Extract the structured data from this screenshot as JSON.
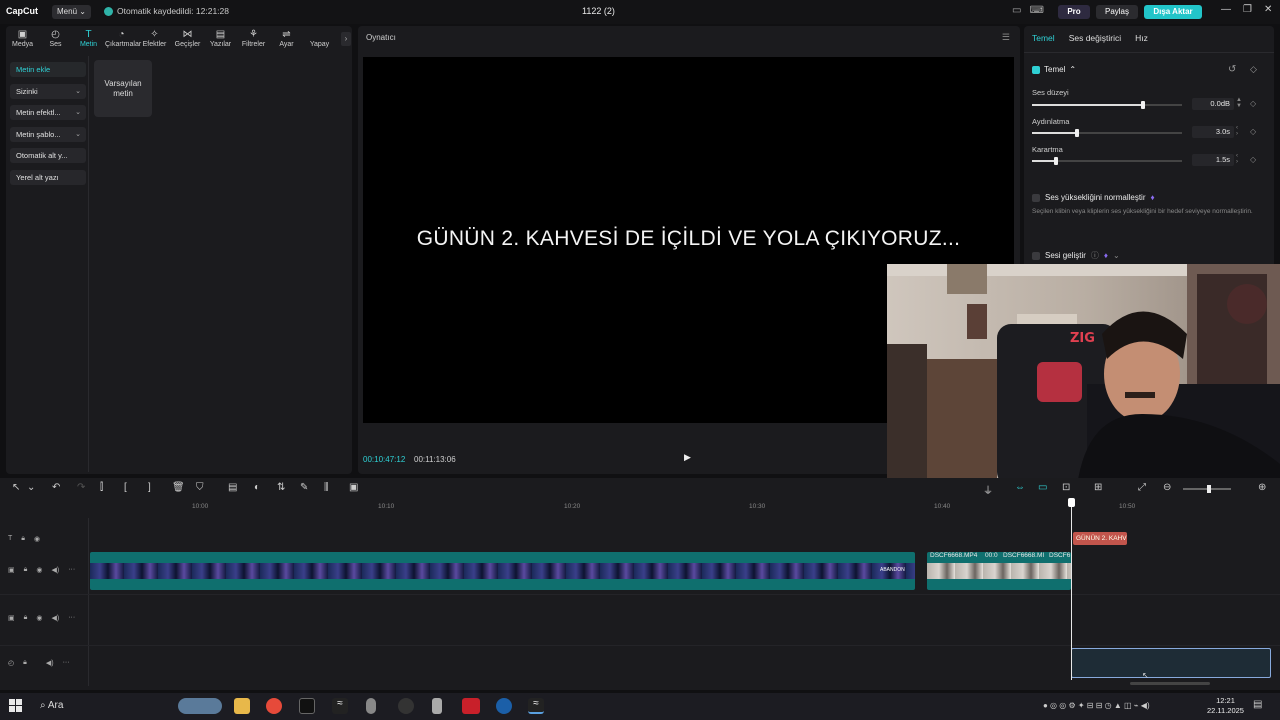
{
  "titlebar": {
    "logo": "CapCut",
    "menu_label": "Menü",
    "autosave_text": "Otomatik kaydedildi: 12:21:28",
    "project_title": "1122 (2)",
    "pro_label": "Pro",
    "share_label": "Paylaş",
    "export_label": "Dışa Aktar"
  },
  "left_tabs": [
    {
      "label": "Medya",
      "icon": "media-icon"
    },
    {
      "label": "Ses",
      "icon": "audio-icon"
    },
    {
      "label": "Metin",
      "icon": "text-icon"
    },
    {
      "label": "Çıkartmalar",
      "icon": "sticker-icon"
    },
    {
      "label": "Efektler",
      "icon": "effects-icon"
    },
    {
      "label": "Geçişler",
      "icon": "transition-icon"
    },
    {
      "label": "Yazılar",
      "icon": "caption-icon"
    },
    {
      "label": "Filtreler",
      "icon": "filter-icon"
    },
    {
      "label": "Ayar",
      "icon": "adjust-icon"
    },
    {
      "label": "Yapay",
      "icon": "ai-icon"
    }
  ],
  "text_sidebar": [
    {
      "label": "Metin ekle",
      "chevron": false
    },
    {
      "label": "Sizinki",
      "chevron": true
    },
    {
      "label": "Metin efektl...",
      "chevron": true
    },
    {
      "label": "Metin şablo...",
      "chevron": true
    },
    {
      "label": "Otomatik alt y...",
      "chevron": false
    },
    {
      "label": "Yerel alt yazı",
      "chevron": false
    }
  ],
  "preset_card": {
    "line1": "Varsayılan",
    "line2": "metin"
  },
  "player": {
    "label": "Oynatıcı",
    "caption": "GÜNÜN 2. KAHVESİ DE İÇİLDİ VE YOLA ÇIKIYORUZ...",
    "current_time": "00:10:47:12",
    "total_time": "00:11:13:06"
  },
  "right_panel": {
    "tabs": [
      "Temel",
      "Ses değiştirici",
      "Hız"
    ],
    "section_title": "Temel",
    "params": [
      {
        "label": "Ses düzeyi",
        "value": "0.0dB",
        "level": 0.74
      },
      {
        "label": "Aydınlatma",
        "value": "3.0s",
        "level": 0.3
      },
      {
        "label": "Karartma",
        "value": "1.5s",
        "level": 0.16
      }
    ],
    "normalize_label": "Ses yüksekliğini normalleştir",
    "normalize_desc": "Seçilen klibin veya kliplerin ses yüksekliğini bir hedef seviyeye normalleştirin.",
    "enhance_label": "Sesi geliştir"
  },
  "timeline": {
    "ruler_ticks": [
      "10:00",
      "10:10",
      "10:20",
      "10:30",
      "10:40",
      "10:50"
    ],
    "clip_names_b": [
      "DSCF6668.MP4",
      "00:0",
      "DSCF6668.MI",
      "DSCF6"
    ],
    "text_clip": "GÜNÜN 2. KAHV",
    "clip_a_tag": "ABANDON"
  },
  "taskbar": {
    "search_label": "Ara",
    "time": "12:21",
    "date": "22.11.2025"
  },
  "colors": {
    "accent": "#2fd0d4",
    "export_btn": "#22c5c9",
    "video_clip": "#0f6f6e",
    "text_clip": "#c2554c"
  }
}
